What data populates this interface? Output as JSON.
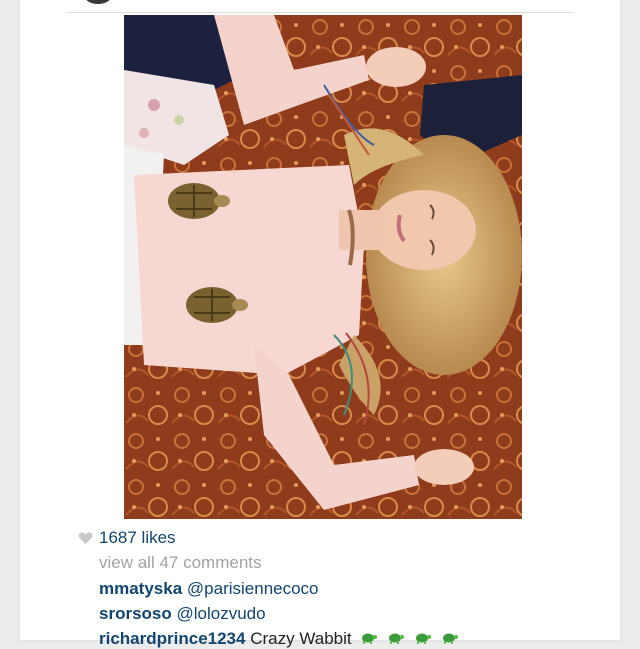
{
  "post": {
    "likes_text": "1687 likes",
    "view_all_text": "view all 47 comments",
    "comments": [
      {
        "user": "mmatyska",
        "text": "@parisiennecoco"
      },
      {
        "user": "srorsoso",
        "text": "@lolozvudo"
      },
      {
        "user": "richardprince1234",
        "text": "Crazy Wabbit",
        "emojis": [
          "turtle-emoji",
          "turtle-emoji",
          "turtle-emoji",
          "turtle-emoji"
        ]
      }
    ]
  },
  "colors": {
    "link_blue": "#12456f",
    "muted_gray": "#a3a3a3",
    "heart_gray": "#c8c8c8"
  },
  "icons": {
    "like": "heart-icon"
  }
}
